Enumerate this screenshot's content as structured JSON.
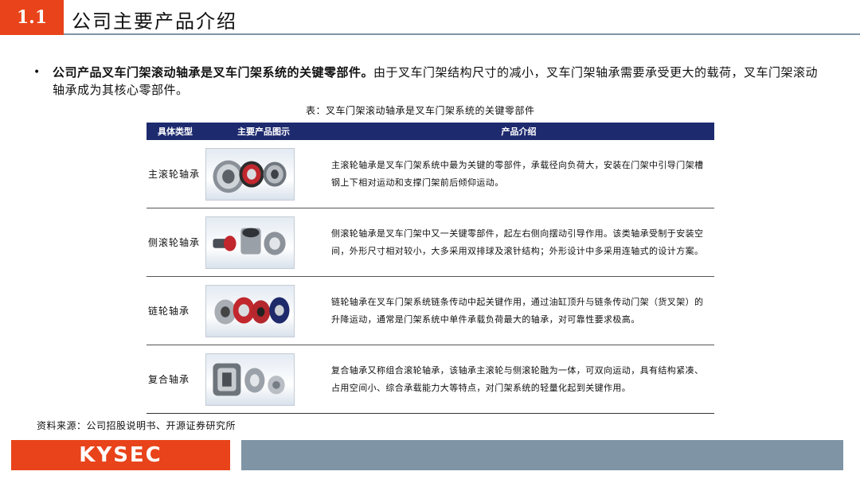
{
  "header": {
    "badge": "1.1",
    "title": "公司主要产品介绍"
  },
  "bullet": {
    "bold": "公司产品叉车门架滚动轴承是叉车门架系统的关键零部件。",
    "rest": "由于叉车门架结构尺寸的减小，叉车门架轴承需要承受更大的载荷，叉车门架滚动轴承成为其核心零部件。"
  },
  "table": {
    "caption": "表：叉车门架滚动轴承是叉车门架系统的关键零部件",
    "headers": [
      "具体类型",
      "主要产品图示",
      "产品介绍"
    ],
    "rows": [
      {
        "type": "主滚轮轴承",
        "desc": "主滚轮轴承是叉车门架系统中最为关键的零部件，承载径向负荷大，安装在门架中引导门架槽钢上下相对运动和支撑门架前后倾仰运动。"
      },
      {
        "type": "侧滚轮轴承",
        "desc": "侧滚轮轴承是叉车门架中又一关键零部件，起左右侧向摆动引导作用。该类轴承受制于安装空间，外形尺寸相对较小，大多采用双排球及滚针结构；外形设计中多采用连轴式的设计方案。"
      },
      {
        "type": "链轮轴承",
        "desc": "链轮轴承在叉车门架系统链条传动中起关键作用，通过油缸顶升与链条传动门架（货叉架）的升降运动，通常是门架系统中单件承载负荷最大的轴承，对可靠性要求极高。"
      },
      {
        "type": "复合轴承",
        "desc": "复合轴承又称组合滚轮轴承，该轴承主滚轮与侧滚轮融为一体，可双向运动，具有结构紧凑、占用空间小、综合承载能力大等特点，对门架系统的轻量化起到关键作用。"
      }
    ]
  },
  "source": "资料来源：公司招股说明书、开源证券研究所",
  "footer": {
    "logo": "KYSEC"
  },
  "colors": {
    "accent": "#e8431a",
    "header_bg": "#1d2a6e",
    "bar": "#7f95a6"
  }
}
